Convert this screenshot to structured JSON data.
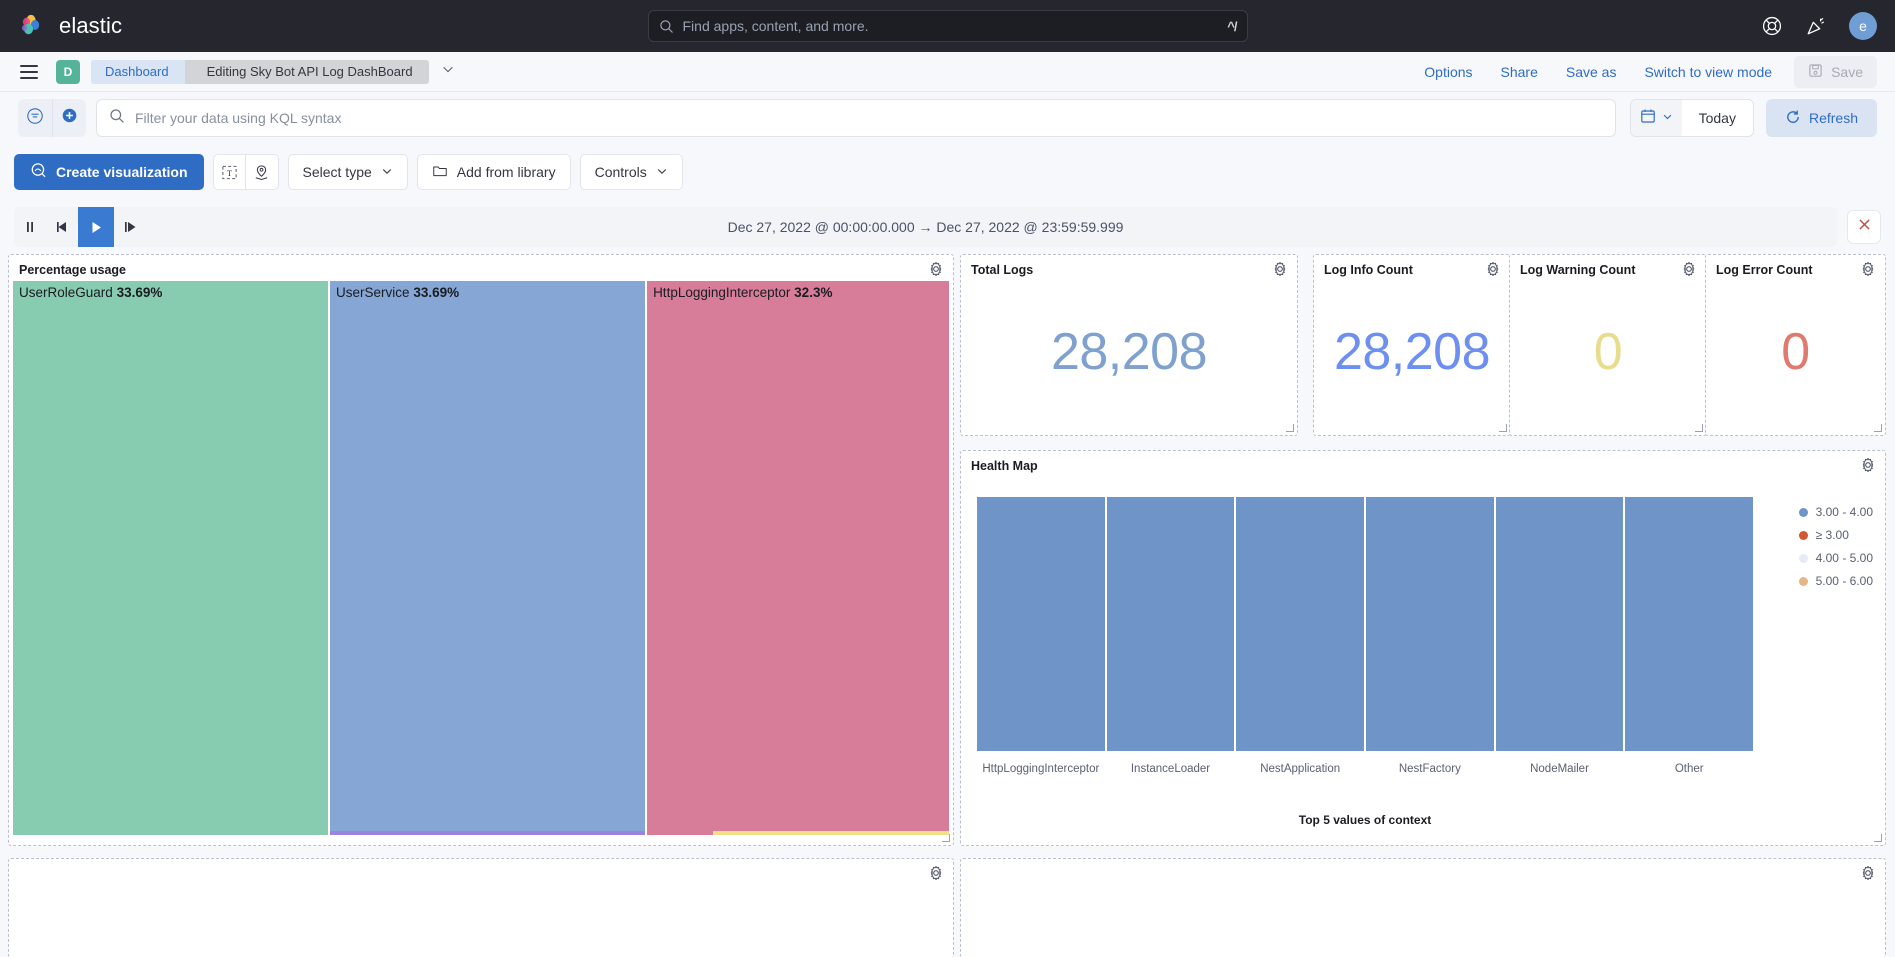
{
  "header": {
    "brand": "elastic",
    "search_placeholder": "Find apps, content, and more.",
    "search_value": "",
    "kbd_hint": "^/",
    "help_icon": "lifebuoy-icon",
    "news_icon": "announcement-icon",
    "avatar_initial": "e"
  },
  "breadcrumb": {
    "space_initial": "D",
    "items": [
      {
        "label": "Dashboard"
      },
      {
        "label": "Editing Sky Bot API Log DashBoard"
      }
    ],
    "actions": [
      {
        "label": "Options"
      },
      {
        "label": "Share"
      },
      {
        "label": "Save as"
      },
      {
        "label": "Switch to view mode"
      }
    ],
    "save_label": "Save"
  },
  "query_bar": {
    "filter_icon": "filter-icon",
    "add_icon": "add-filter-icon",
    "kql_placeholder": "Filter your data using KQL syntax",
    "kql_value": "",
    "calendar_icon": "calendar-icon",
    "date_label": "Today",
    "refresh_label": "Refresh",
    "refresh_icon": "refresh-icon"
  },
  "toolbar": {
    "create_visualization": "Create visualization",
    "text_icon": "text-box-icon",
    "map_icon": "map-layers-icon",
    "select_type": "Select type",
    "add_from_library": "Add from library",
    "controls": "Controls"
  },
  "time_slider": {
    "pause_icon": "pause-icon",
    "prev_icon": "step-backward-icon",
    "play_icon": "play-icon",
    "next_icon": "step-forward-icon",
    "range_text": "Dec 27, 2022 @ 00:00:00.000  →  Dec 27, 2022 @ 23:59:59.999",
    "close_icon": "close-icon"
  },
  "panels": {
    "percentage_usage": {
      "title": "Percentage usage"
    },
    "total_logs": {
      "title": "Total Logs",
      "value": "28,208",
      "color": "#7fa1ce"
    },
    "log_info": {
      "title": "Log Info Count",
      "value": "28,208",
      "color": "#6c8ff0"
    },
    "log_warning": {
      "title": "Log Warning Count",
      "value": "0",
      "color": "#e8dc8d"
    },
    "log_error": {
      "title": "Log Error Count",
      "value": "0",
      "color": "#e07a6e"
    },
    "health_map": {
      "title": "Health Map"
    }
  },
  "chart_data": [
    {
      "type": "treemap",
      "title": "Percentage usage",
      "categories": [
        "UserRoleGuard",
        "UserService",
        "HttpLoggingInterceptor"
      ],
      "values": [
        33.69,
        33.69,
        32.3
      ],
      "value_labels": [
        "33.69%",
        "33.69%",
        "32.3%"
      ],
      "colors": [
        "#87ccb0",
        "#86a6d6",
        "#d87d99"
      ],
      "underbar_colors": [
        "#ffffff",
        "#9b84e0",
        "#f0e08a"
      ]
    },
    {
      "type": "bar",
      "title": "Health Map",
      "xlabel": "Top 5 values of context",
      "ylabel": "",
      "categories": [
        "HttpLoggingInterceptor",
        "InstanceLoader",
        "NestApplication",
        "NestFactory",
        "NodeMailer",
        "Other"
      ],
      "values": [
        1,
        1,
        1,
        1,
        1,
        1
      ],
      "bar_color": "#6f94c8",
      "grid": false,
      "legend_position": "right",
      "legend": [
        {
          "label": "3.00 - 4.00",
          "color": "#6f94c8"
        },
        {
          "label": "≥ 3.00",
          "color": "#d4552f"
        },
        {
          "label": "4.00 - 5.00",
          "color": "#e6ecf5"
        },
        {
          "label": "5.00 - 6.00",
          "color": "#e8b584"
        }
      ]
    }
  ]
}
